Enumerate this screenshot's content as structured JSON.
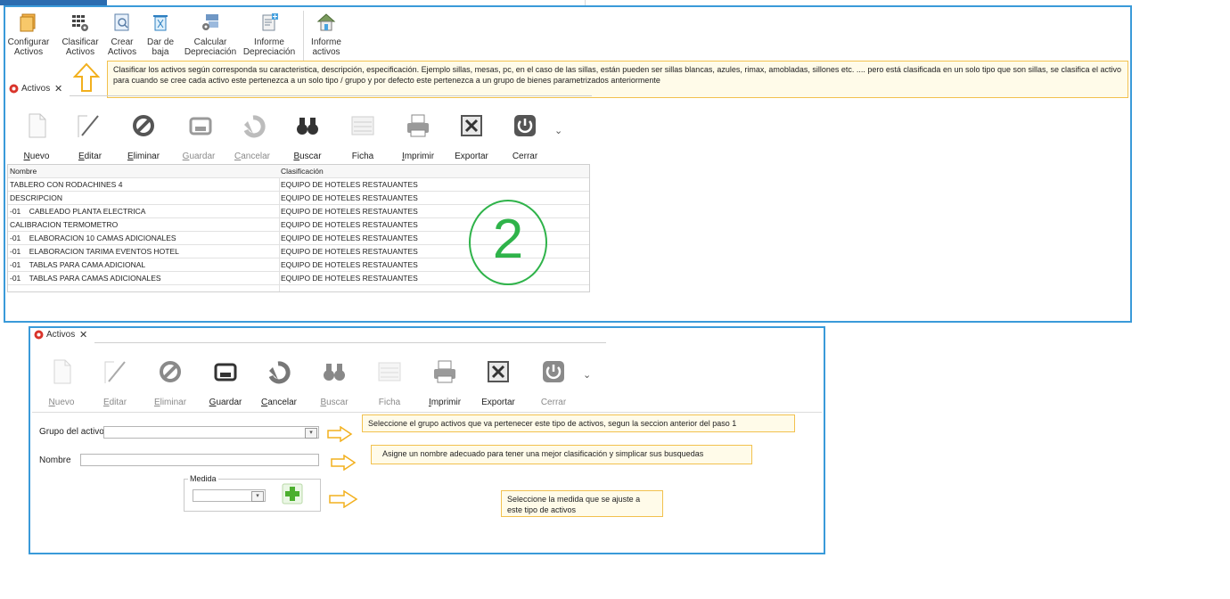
{
  "ribbon": {
    "buttons": [
      {
        "line1": "Configurar",
        "line2": "Activos"
      },
      {
        "line1": "Clasificar",
        "line2": "Activos"
      },
      {
        "line1": "Crear",
        "line2": "Activos"
      },
      {
        "line1": "Dar de",
        "line2": "baja"
      },
      {
        "line1": "Calcular",
        "line2": "Depreciación"
      },
      {
        "line1": "Informe",
        "line2": "Depreciación"
      },
      {
        "line1": "Informe",
        "line2": "activos"
      }
    ]
  },
  "note_top": "Clasificar los activos según corresponda su caracteristica, descripción, especificación. Ejemplo sillas, mesas, pc, en el caso de las sillas, están pueden ser sillas blancas, azules, rimax, amobladas, sillones etc. .... pero está clasificada en un solo tipo que son sillas, se clasifica el activo para cuando se cree cada activo este pertenezca a un solo tipo / grupo y por defecto  este pertenezca a un grupo de bienes parametrizados anteriormente",
  "panel1": {
    "tab_label": "Activos",
    "toolbar": [
      {
        "label": "Nuevo",
        "u": "N",
        "rest": "uevo",
        "enabled": true
      },
      {
        "label": "Editar",
        "u": "E",
        "rest": "ditar",
        "enabled": true
      },
      {
        "label": "Eliminar",
        "u": "E",
        "rest": "liminar",
        "enabled": true
      },
      {
        "label": "Guardar",
        "u": "G",
        "rest": "uardar",
        "enabled": false
      },
      {
        "label": "Cancelar",
        "u": "C",
        "rest": "ancelar",
        "enabled": false
      },
      {
        "label": "Buscar",
        "u": "B",
        "rest": "uscar",
        "enabled": true
      },
      {
        "label": "Ficha",
        "u": "",
        "rest": "Ficha",
        "enabled": true
      },
      {
        "label": "Imprimir",
        "u": "I",
        "rest": "mprimir",
        "enabled": true
      },
      {
        "label": "Exportar",
        "u": "",
        "rest": "Exportar",
        "enabled": true
      },
      {
        "label": "Cerrar",
        "u": "",
        "rest": "Cerrar",
        "enabled": true
      }
    ],
    "grid": {
      "columns": [
        "Nombre",
        "Clasificación"
      ],
      "rows": [
        [
          "TABLERO CON RODACHINES 4",
          "EQUIPO DE HOTELES RESTAUANTES"
        ],
        [
          "DESCRIPCION",
          "EQUIPO DE HOTELES RESTAUANTES"
        ],
        [
          "-01    CABLEADO PLANTA ELECTRICA",
          "EQUIPO DE HOTELES RESTAUANTES"
        ],
        [
          "CALIBRACION TERMOMETRO",
          "EQUIPO DE HOTELES RESTAUANTES"
        ],
        [
          "-01    ELABORACION 10 CAMAS ADICIONALES",
          "EQUIPO DE HOTELES RESTAUANTES"
        ],
        [
          "-01    ELABORACION TARIMA EVENTOS HOTEL",
          "EQUIPO DE HOTELES RESTAUANTES"
        ],
        [
          "-01    TABLAS PARA CAMA ADICIONAL",
          "EQUIPO DE HOTELES RESTAUANTES"
        ],
        [
          "-01    TABLAS PARA CAMAS ADICIONALES",
          "EQUIPO DE HOTELES RESTAUANTES"
        ]
      ]
    },
    "step_number": "2"
  },
  "panel2": {
    "tab_label": "Activos",
    "toolbar": [
      {
        "u": "N",
        "rest": "uevo",
        "enabled": false
      },
      {
        "u": "E",
        "rest": "ditar",
        "enabled": false
      },
      {
        "u": "E",
        "rest": "liminar",
        "enabled": false
      },
      {
        "u": "G",
        "rest": "uardar",
        "enabled": true
      },
      {
        "u": "C",
        "rest": "ancelar",
        "enabled": true
      },
      {
        "u": "B",
        "rest": "uscar",
        "enabled": false
      },
      {
        "u": "",
        "rest": "Ficha",
        "enabled": false
      },
      {
        "u": "I",
        "rest": "mprimir",
        "enabled": true
      },
      {
        "u": "",
        "rest": "Exportar",
        "enabled": true
      },
      {
        "u": "",
        "rest": "Cerrar",
        "enabled": false
      }
    ],
    "form": {
      "grupo_label": "Grupo del activo",
      "grupo_value": "",
      "nombre_label": "Nombre",
      "nombre_value": "",
      "medida_label": "Medida",
      "medida_value": ""
    },
    "notes": {
      "grupo": "Seleccione el grupo activos que va pertenecer este tipo de activos, segun la seccion anterior del paso 1",
      "nombre": "Asigne un nombre adecuado para tener una mejor clasificación y simplicar sus busquedas",
      "medida": "Seleccione la medida que se ajuste a este tipo de activos"
    }
  },
  "colors": {
    "panel_border": "#3a9ad9",
    "note_bg": "#fffbe9",
    "note_border": "#f2c14e",
    "arrow": "#f2b01e",
    "step_circle": "#2fb34a"
  }
}
